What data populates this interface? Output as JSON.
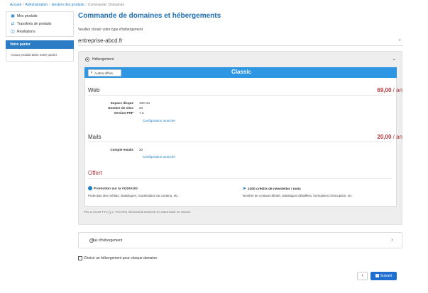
{
  "breadcrumb": [
    {
      "label": "Accueil",
      "current": false
    },
    {
      "label": "Administration",
      "current": false
    },
    {
      "label": "Gestion des produits",
      "current": false
    },
    {
      "label": "Commande: Domaines",
      "current": true
    }
  ],
  "sidebar": {
    "items": [
      {
        "label": "Mes produits",
        "icon": "box-icon"
      },
      {
        "label": "Transferts de produits",
        "icon": "transfer-icon"
      },
      {
        "label": "Résiliations",
        "icon": "trash-icon"
      }
    ],
    "cart_title": "Votre panier",
    "cart_empty": "Aucun produit dans votre panier."
  },
  "main": {
    "title": "Commande de domaines et hébergements",
    "choose_label": "Veuillez choisir votre type d'hébergement",
    "domain": "entreprise-abcd.fr",
    "clear_icon": "×"
  },
  "hosting": {
    "label": "Hébergement",
    "selected": true,
    "other_offers": "Autres offres",
    "plan_name": "Classic",
    "web": {
      "title": "Web",
      "price": "69,00",
      "unit": "/ an",
      "specs": [
        {
          "key": "Espace disque",
          "value": "100 Go"
        },
        {
          "key": "Nombre de sites",
          "value": "20"
        },
        {
          "key": "Version PHP",
          "value": "7.3"
        }
      ],
      "config_link": "Configuration avancée"
    },
    "mails": {
      "title": "Mails",
      "price": "20,00",
      "unit": "/ an",
      "specs": [
        {
          "key": "Compte emails",
          "value": "20"
        }
      ],
      "config_link": "Configuration avancée"
    },
    "offert": {
      "title": "Offert",
      "promos": [
        {
          "title": "Promotion sur la VOD/AOD",
          "desc": "Protection des médias, statistiques, monétisation du contenu, etc.",
          "icon": "info-icon"
        },
        {
          "title": "2300 crédits de newsletter / mois",
          "desc": "Nombre de contacts illimité, statistiques détaillées, formulaires d'inscription, etc.",
          "icon": "send-icon"
        }
      ]
    },
    "price_note": "Prix en EUR TTC (y.c. TVA 0%) Infomaniak Network SA étant basé en Suisse."
  },
  "no_hosting": {
    "label": "Pas d'hébergement",
    "selected": false
  },
  "per_domain": {
    "label": "Choisir un hébergement pour chaque domaine",
    "checked": false
  },
  "nav": {
    "next_label": "Suivant"
  },
  "colors": {
    "accent": "#1f6fb5",
    "plan_bar": "#2e96e3",
    "price": "#b5363b",
    "next_button": "#1f6fd0"
  }
}
